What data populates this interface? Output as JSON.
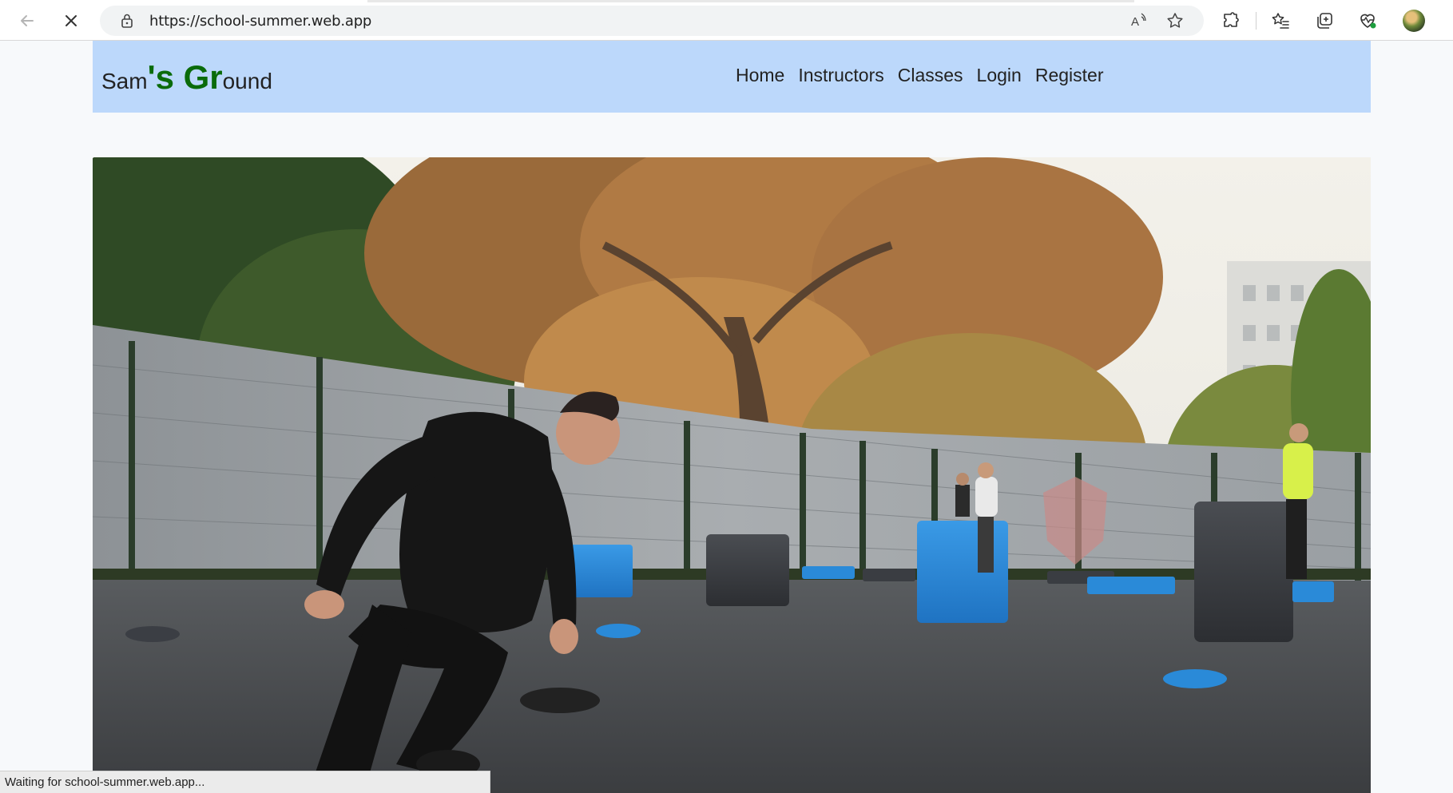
{
  "browser": {
    "url": "https://school-summer.web.app",
    "status_text": "Waiting for school-summer.web.app...",
    "icons": [
      "back-arrow-icon",
      "stop-loading-icon",
      "lock-icon",
      "read-aloud-icon",
      "favorite-star-icon",
      "extensions-icon",
      "favorites-icon",
      "collections-icon",
      "browser-essentials-icon",
      "profile-avatar"
    ]
  },
  "site": {
    "logo": {
      "part1": "Sam",
      "part2": "'s Gr",
      "part3": "ound"
    },
    "nav": [
      "Home",
      "Instructors",
      "Classes",
      "Login",
      "Register"
    ],
    "colors": {
      "header_bg": "#bcd8fb",
      "logo_accent": "#0a6b0a"
    }
  },
  "hero": {
    "image_subject": "outdoor fitness training photo"
  }
}
